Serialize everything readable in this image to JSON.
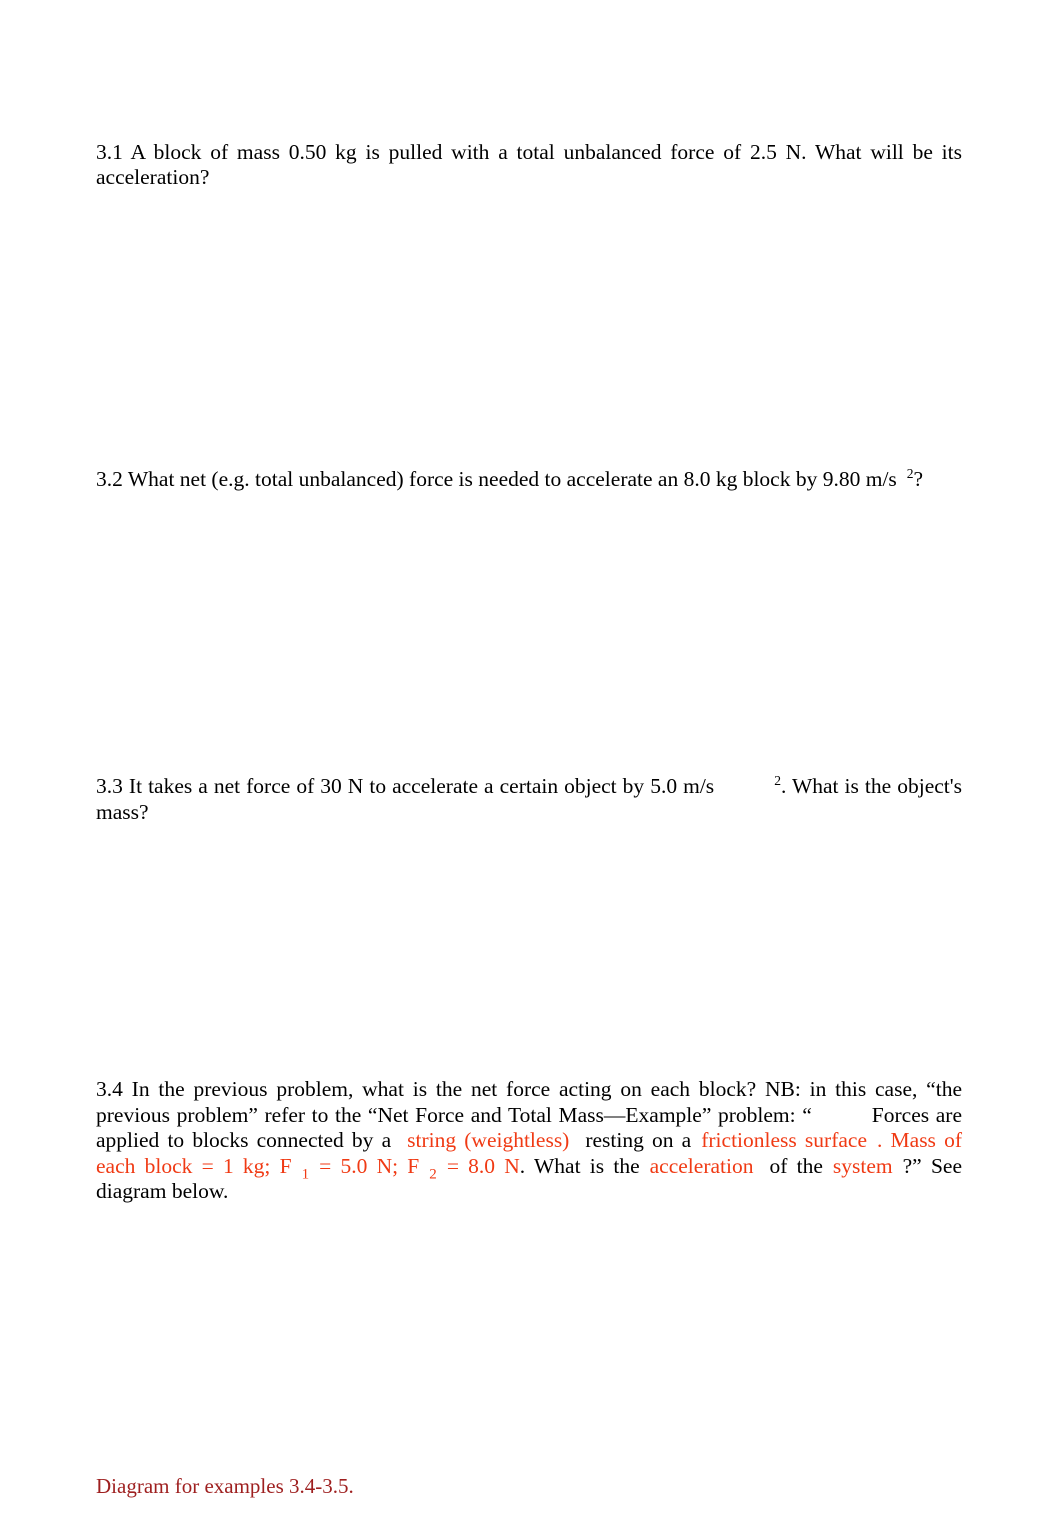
{
  "document": {
    "background_color": "#ffffff",
    "text_color": "#000000",
    "accent_red": "#f03a14",
    "caption_red": "#9e1f1f"
  },
  "questions": [
    {
      "id": "3.1",
      "text": "3.1 A block of mass 0.50 kg is pulled with a total unbalanced force of 2.5 N. What will be its acceleration?"
    },
    {
      "id": "3.2",
      "lead": "3.2 What net (e.g. total unbalanced) force is needed to accelerate an 8.0 kg block by 9.80 m/s",
      "superscript": "2",
      "tail": "?"
    },
    {
      "id": "3.3",
      "lead": "3.3 It takes a net force of 30 N to accelerate a certain object by 5.0 m/s",
      "superscript": "2",
      "tail": ". What is the object's mass?"
    },
    {
      "id": "3.4",
      "seg1": "3.4 In the previous problem, what is the net force acting on each block? NB: in this case, “the previous problem” refer to the “Net Force and Total Mass—Example” problem: “",
      "seg2": "Forces are applied to blocks connected by a",
      "seg3_red": "string (weightless)",
      "seg4": "resting on a",
      "seg5_red": "frictionless surface",
      "seg6_red": ". Mass of each block = 1 kg; F",
      "sub1": "1",
      "seg7_red": "= 5.0 N; F",
      "sub2": "2",
      "seg8_red": "= 8.0 N",
      "seg9": ". What is the",
      "seg10_red": "acceleration",
      "seg11": "of the",
      "seg12_red": "system",
      "seg13": "?” See diagram below."
    }
  ],
  "caption": {
    "text": "Diagram for examples 3.4-3.5."
  }
}
